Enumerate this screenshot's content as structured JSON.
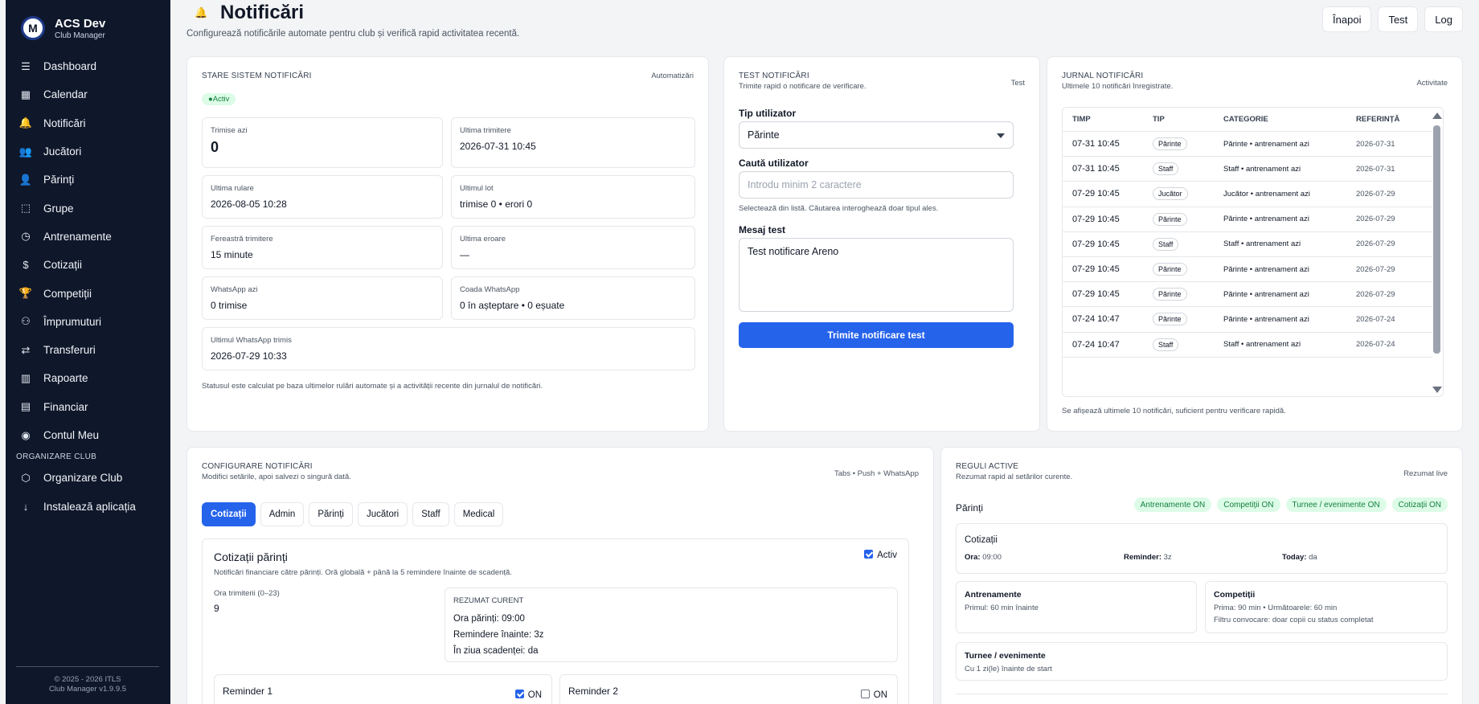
{
  "brand": {
    "name": "ACS Dev",
    "sub": "Club Manager",
    "logo_letter": "M"
  },
  "sidebar": {
    "items": [
      {
        "label": "Dashboard",
        "icon": "menu-icon",
        "glyph": "☰"
      },
      {
        "label": "Calendar",
        "icon": "calendar-icon",
        "glyph": "▦"
      },
      {
        "label": "Notificări",
        "icon": "bell-icon",
        "glyph": "🔔"
      },
      {
        "label": "Jucători",
        "icon": "users-icon",
        "glyph": "👥"
      },
      {
        "label": "Părinți",
        "icon": "user-icon",
        "glyph": "👤"
      },
      {
        "label": "Grupe",
        "icon": "group-icon",
        "glyph": "⬚"
      },
      {
        "label": "Antrenamente",
        "icon": "clock-icon",
        "glyph": "◷"
      },
      {
        "label": "Cotizații",
        "icon": "dollar-icon",
        "glyph": "$"
      },
      {
        "label": "Competiții",
        "icon": "trophy-icon",
        "glyph": "🏆"
      },
      {
        "label": "Împrumuturi",
        "icon": "share-icon",
        "glyph": "⚇"
      },
      {
        "label": "Transferuri",
        "icon": "user-plus-icon",
        "glyph": "⇄"
      },
      {
        "label": "Rapoarte",
        "icon": "chart-icon",
        "glyph": "▥"
      },
      {
        "label": "Financiar",
        "icon": "file-icon",
        "glyph": "▤"
      },
      {
        "label": "Contul Meu",
        "icon": "account-icon",
        "glyph": "◉"
      }
    ],
    "section": "ORGANIZARE CLUB",
    "items2": [
      {
        "label": "Organizare Club",
        "icon": "shield-icon",
        "glyph": "⬡"
      },
      {
        "label": "Instalează aplicația",
        "icon": "download-icon",
        "glyph": "↓"
      }
    ],
    "footer1": "© 2025 - 2026 ITLS",
    "footer2": "Club Manager v1.9.9.5"
  },
  "header": {
    "title": "Notificări",
    "subtitle": "Configurează notificările automate pentru club și verifică rapid activitatea recentă.",
    "buttons": [
      "Înapoi",
      "Test",
      "Log"
    ]
  },
  "status": {
    "heading": "STARE SISTEM NOTIFICĂRI",
    "right": "Automatizări",
    "badge": "●Activ",
    "stats": [
      {
        "label": "Trimise azi",
        "value": "0"
      },
      {
        "label": "Ultima trimitere",
        "value": "2026-07-31 10:45"
      },
      {
        "label": "Ultima rulare",
        "value": "2026-08-05 10:28"
      },
      {
        "label": "Ultimul lot",
        "value": "trimise 0 • erori 0"
      },
      {
        "label": "Fereastră trimitere",
        "value": "15 minute"
      },
      {
        "label": "Ultima eroare",
        "value": "—"
      },
      {
        "label": "WhatsApp azi",
        "value": "0 trimise"
      },
      {
        "label": "Coada WhatsApp",
        "value": "0 în așteptare • 0 eșuate"
      },
      {
        "label": "Ultimul WhatsApp trimis",
        "value": "2026-07-29 10:33"
      }
    ],
    "note": "Statusul este calculat pe baza ultimelor rulări automate și a activității recente din jurnalul de notificări."
  },
  "test": {
    "heading": "TEST NOTIFICĂRI",
    "sub": "Trimite rapid o notificare de verificare.",
    "right": "Test",
    "type_label": "Tip utilizator",
    "type_value": "Părinte",
    "search_label": "Caută utilizator",
    "search_placeholder": "Introdu minim 2 caractere",
    "hint": "Selectează din listă. Căutarea interoghează doar tipul ales.",
    "msg_label": "Mesaj test",
    "msg_value": "Test notificare Areno",
    "send": "Trimite notificare test"
  },
  "journal": {
    "heading": "JURNAL NOTIFICĂRI",
    "sub": "Ultimele 10 notificări înregistrate.",
    "right": "Activitate",
    "columns": [
      "TIMP",
      "TIP",
      "CATEGORIE",
      "REFERINȚĂ"
    ],
    "rows": [
      {
        "time": "07-31 10:45",
        "type": "Părinte",
        "cat": "Părinte • antrenament azi",
        "ref": "2026-07-31"
      },
      {
        "time": "07-31 10:45",
        "type": "Staff",
        "cat": "Staff • antrenament azi",
        "ref": "2026-07-31"
      },
      {
        "time": "07-29 10:45",
        "type": "Jucător",
        "cat": "Jucător • antrenament azi",
        "ref": "2026-07-29"
      },
      {
        "time": "07-29 10:45",
        "type": "Părinte",
        "cat": "Părinte • antrenament azi",
        "ref": "2026-07-29"
      },
      {
        "time": "07-29 10:45",
        "type": "Staff",
        "cat": "Staff • antrenament azi",
        "ref": "2026-07-29"
      },
      {
        "time": "07-29 10:45",
        "type": "Părinte",
        "cat": "Părinte • antrenament azi",
        "ref": "2026-07-29"
      },
      {
        "time": "07-29 10:45",
        "type": "Părinte",
        "cat": "Părinte • antrenament azi",
        "ref": "2026-07-29"
      },
      {
        "time": "07-24 10:47",
        "type": "Părinte",
        "cat": "Părinte • antrenament azi",
        "ref": "2026-07-24"
      },
      {
        "time": "07-24 10:47",
        "type": "Staff",
        "cat": "Staff • antrenament azi",
        "ref": "2026-07-24"
      }
    ],
    "note": "Se afișează ultimele 10 notificări, suficient pentru verificare rapidă."
  },
  "config": {
    "heading": "CONFIGURARE NOTIFICĂRI",
    "sub": "Modifici setările, apoi salvezi o singură dată.",
    "right": "Tabs • Push + WhatsApp",
    "tabs": [
      "Cotizații",
      "Admin",
      "Părinți",
      "Jucători",
      "Staff",
      "Medical"
    ],
    "panel_title": "Cotizații părinți",
    "panel_active": "Activ",
    "panel_desc": "Notificări financiare către părinți. Oră globală + până la 5 remindere înainte de scadență.",
    "hour_label": "Ora trimiterii (0–23)",
    "hour_value": "9",
    "summary_title": "REZUMAT CURENT",
    "summary_lines": [
      "Ora părinți: 09:00",
      "Remindere înainte: 3z",
      "În ziua scadenței: da"
    ],
    "reminder1": "Reminder 1",
    "reminder2": "Reminder 2",
    "on": "ON"
  },
  "rules": {
    "heading": "REGULI ACTIVE",
    "sub": "Rezumat rapid al setărilor curente.",
    "right": "Rezumat live",
    "group": "Părinți",
    "pills": [
      "Antrenamente ON",
      "Competiții ON",
      "Turnee / evenimente ON",
      "Cotizații ON"
    ],
    "cot_title": "Cotizații",
    "cot_ora_k": "Ora:",
    "cot_ora_v": "09:00",
    "cot_rem_k": "Reminder:",
    "cot_rem_v": "3z",
    "cot_today_k": "Today:",
    "cot_today_v": "da",
    "antr_title": "Antrenamente",
    "antr_desc": "Primul: 60 min înainte",
    "comp_title": "Competiții",
    "comp_desc1": "Prima: 90 min • Următoarele: 60 min",
    "comp_desc2": "Filtru convocare: doar copii cu status completat",
    "turnee_title": "Turnee / evenimente",
    "turnee_desc": "Cu 1 zi(le) înainte de start"
  },
  "colors": {
    "accent": "#2563eb",
    "sidebar": "#0f172a",
    "success": "#15803d"
  }
}
